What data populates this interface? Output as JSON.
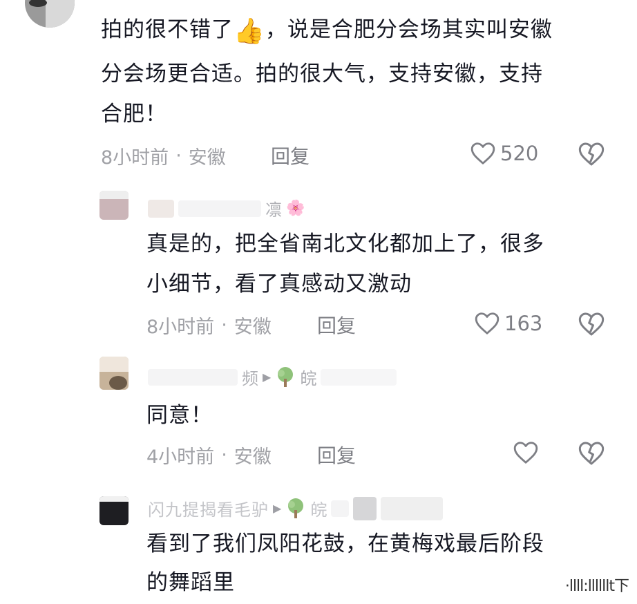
{
  "comments": [
    {
      "text_lines": [
        "拍的很不错了",
        "，说是合肥分会场其实叫安徽",
        "分会场更合适。拍的很大气，支持安徽，支持",
        "合肥！"
      ],
      "emoji": "👍",
      "time": "8小时前",
      "location": "安徽",
      "reply": "回复",
      "likes": "520"
    },
    {
      "username_fragment": "凛",
      "username_emoji": "🌸",
      "text_lines": [
        "真是的，把全省南北文化都加上了，很多",
        "小细节，看了真感动又激动"
      ],
      "time": "8小时前",
      "location": "安徽",
      "reply": "回复",
      "likes": "163"
    },
    {
      "username_fragment": "频",
      "reply_to": "皖",
      "text_lines": [
        "同意！"
      ],
      "time": "4小时前",
      "location": "安徽",
      "reply": "回复",
      "likes": ""
    },
    {
      "username_fragment": "闪九提揭看毛驴",
      "reply_to": "皖",
      "text_lines": [
        "看到了我们凤阳花鼓，在黄梅戏最后阶段",
        "的舞蹈里"
      ]
    }
  ],
  "meta_separator": "·",
  "watermark": "·llll:llllllt下",
  "icons": {
    "like": "heart-outline-icon",
    "dislike": "broken-heart-icon",
    "tree": "tree-icon",
    "play": "play-arrow-icon"
  }
}
